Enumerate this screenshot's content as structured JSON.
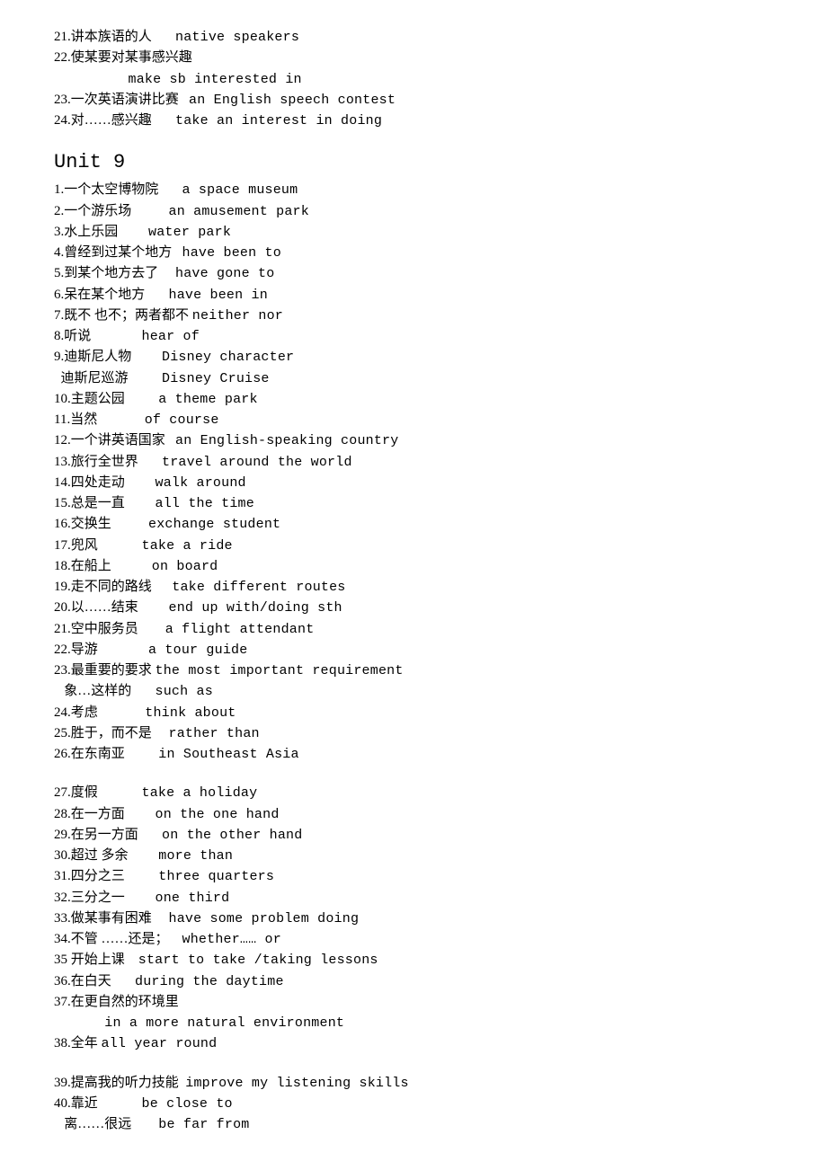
{
  "top": [
    {
      "zh": "21.讲本族语的人       ",
      "en": "native speakers"
    },
    {
      "zh": "22.使某要对某事感兴趣",
      "en": ""
    },
    {
      "zh": "                      ",
      "en": "make sb interested in"
    },
    {
      "zh": "23.一次英语演讲比赛   ",
      "en": "an English speech contest"
    },
    {
      "zh": "24.对……感兴趣       ",
      "en": "take an interest in doing"
    }
  ],
  "unit_title": "Unit 9",
  "items": [
    {
      "zh": "1.一个太空博物院       ",
      "en": "a space museum"
    },
    {
      "zh": "2.一个游乐场           ",
      "en": "an amusement park"
    },
    {
      "zh": "3.水上乐园         ",
      "en": "water park"
    },
    {
      "zh": "4.曾经到过某个地方   ",
      "en": "have been to"
    },
    {
      "zh": "5.到某个地方去了     ",
      "en": "have gone to"
    },
    {
      "zh": "6.呆在某个地方       ",
      "en": "have been in"
    },
    {
      "zh": "7.既不 也不；两者都不 ",
      "en": "neither nor"
    },
    {
      "zh": "8.听说               ",
      "en": "hear of"
    },
    {
      "zh": "9.迪斯尼人物         ",
      "en": "Disney character"
    },
    {
      "zh": "  迪斯尼巡游          ",
      "en": "Disney Cruise"
    },
    {
      "zh": "10.主题公园          ",
      "en": "a theme park"
    },
    {
      "zh": "11.当然              ",
      "en": "of course"
    },
    {
      "zh": "12.一个讲英语国家   ",
      "en": "an English-speaking country"
    },
    {
      "zh": "13.旅行全世界       ",
      "en": "travel around the world"
    },
    {
      "zh": "14.四处走动         ",
      "en": "walk around"
    },
    {
      "zh": "15.总是一直         ",
      "en": "all the time"
    },
    {
      "zh": "16.交换生           ",
      "en": "exchange student"
    },
    {
      "zh": "17.兜风             ",
      "en": "take a ride"
    },
    {
      "zh": "18.在船上            ",
      "en": "on board"
    },
    {
      "zh": "19.走不同的路线      ",
      "en": "take different routes"
    },
    {
      "zh": "20.以……结束         ",
      "en": "end up with/doing sth"
    },
    {
      "zh": "21.空中服务员        ",
      "en": "a flight attendant"
    },
    {
      "zh": "22.导游               ",
      "en": "a tour guide"
    },
    {
      "zh": "23.最重要的要求 ",
      "en": "the most important requirement"
    },
    {
      "zh": "   象…这样的       ",
      "en": "such as"
    },
    {
      "zh": "24.考虑              ",
      "en": "think about"
    },
    {
      "zh": "25.胜于，而不是     ",
      "en": "rather than"
    },
    {
      "zh": "26.在东南亚          ",
      "en": "in Southeast Asia"
    },
    {
      "blank": true
    },
    {
      "zh": "27.度假             ",
      "en": "take a holiday"
    },
    {
      "zh": "28.在一方面         ",
      "en": "on the one hand"
    },
    {
      "zh": "29.在另一方面       ",
      "en": "on the other hand"
    },
    {
      "zh": "30.超过 多余         ",
      "en": "more than"
    },
    {
      "zh": "31.四分之三          ",
      "en": "three quarters"
    },
    {
      "zh": "32.三分之一         ",
      "en": "one third"
    },
    {
      "zh": "33.做某事有困难     ",
      "en": "have some problem doing"
    },
    {
      "zh": "34.不管 ……还是；    ",
      "en": "whether…… or"
    },
    {
      "zh": "35 开始上课    ",
      "en": "start to take /taking lessons"
    },
    {
      "zh": "36.在白天       ",
      "en": "during the daytime"
    },
    {
      "zh": "37.在更自然的环境里",
      "en": ""
    },
    {
      "zh": "               ",
      "en": "in a more natural environment"
    },
    {
      "zh": "38.全年 ",
      "en": "all year round"
    },
    {
      "blank": true
    },
    {
      "zh": "39.提高我的听力技能  ",
      "en": "improve my listening skills"
    },
    {
      "zh": "40.靠近             ",
      "en": "be close to"
    },
    {
      "zh": "   离……很远        ",
      "en": "be far from"
    }
  ]
}
